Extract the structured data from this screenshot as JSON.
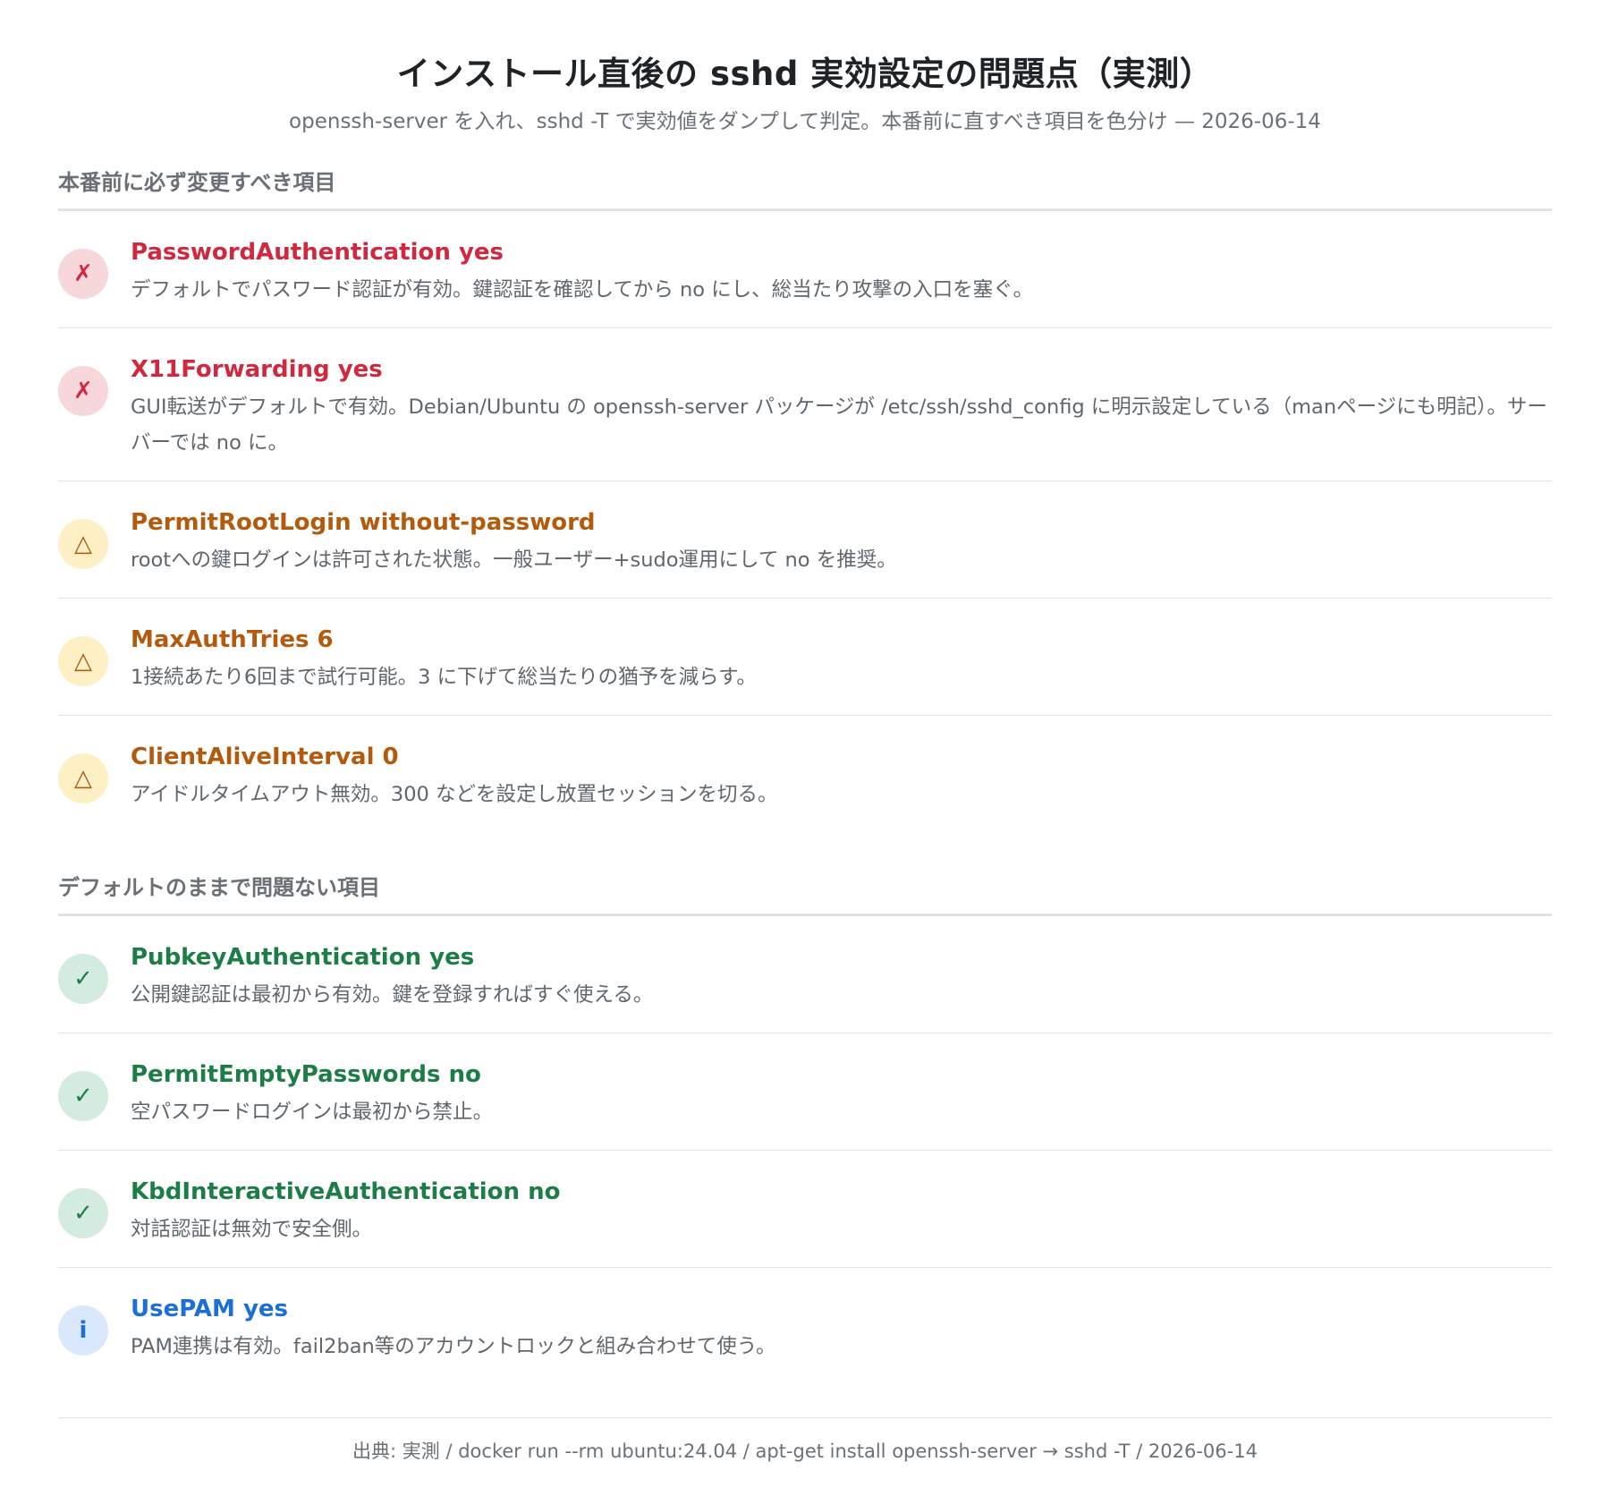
{
  "header": {
    "title": "インストール直後の sshd 実効設定の問題点（実測）",
    "subtitle": "openssh-server を入れ、sshd -T で実効値をダンプして判定。本番前に直すべき項目を色分け — 2026-06-14"
  },
  "sections": [
    {
      "heading": "本番前に必ず変更すべき項目",
      "items": [
        {
          "status": "bad",
          "icon": "cross-icon",
          "glyph": "✗",
          "title": "PasswordAuthentication yes",
          "desc": "デフォルトでパスワード認証が有効。鍵認証を確認してから no にし、総当たり攻撃の入口を塞ぐ。"
        },
        {
          "status": "bad",
          "icon": "cross-icon",
          "glyph": "✗",
          "title": "X11Forwarding yes",
          "desc": "GUI転送がデフォルトで有効。Debian/Ubuntu の openssh-server パッケージが /etc/ssh/sshd_config に明示設定している（manページにも明記）。サーバーでは no に。"
        },
        {
          "status": "warn",
          "icon": "warning-triangle-icon",
          "glyph": "△",
          "title": "PermitRootLogin without-password",
          "desc": "rootへの鍵ログインは許可された状態。一般ユーザー+sudo運用にして no を推奨。"
        },
        {
          "status": "warn",
          "icon": "warning-triangle-icon",
          "glyph": "△",
          "title": "MaxAuthTries 6",
          "desc": "1接続あたり6回まで試行可能。3 に下げて総当たりの猶予を減らす。"
        },
        {
          "status": "warn",
          "icon": "warning-triangle-icon",
          "glyph": "△",
          "title": "ClientAliveInterval 0",
          "desc": "アイドルタイムアウト無効。300 などを設定し放置セッションを切る。"
        }
      ]
    },
    {
      "heading": "デフォルトのままで問題ない項目",
      "items": [
        {
          "status": "ok",
          "icon": "check-icon",
          "glyph": "✓",
          "title": "PubkeyAuthentication yes",
          "desc": "公開鍵認証は最初から有効。鍵を登録すればすぐ使える。"
        },
        {
          "status": "ok",
          "icon": "check-icon",
          "glyph": "✓",
          "title": "PermitEmptyPasswords no",
          "desc": "空パスワードログインは最初から禁止。"
        },
        {
          "status": "ok",
          "icon": "check-icon",
          "glyph": "✓",
          "title": "KbdInteractiveAuthentication no",
          "desc": "対話認証は無効で安全側。"
        },
        {
          "status": "info",
          "icon": "info-icon",
          "glyph": "i",
          "title": "UsePAM yes",
          "desc": "PAM連携は有効。fail2ban等のアカウントロックと組み合わせて使う。"
        }
      ]
    }
  ],
  "footer": {
    "source": "出典: 実測 / docker run --rm ubuntu:24.04 / apt-get install openssh-server → sshd -T / 2026-06-14"
  },
  "colors": {
    "bad": "#d0283e",
    "warn": "#b45a0c",
    "ok": "#1c7d46",
    "info": "#1a6fd8"
  }
}
